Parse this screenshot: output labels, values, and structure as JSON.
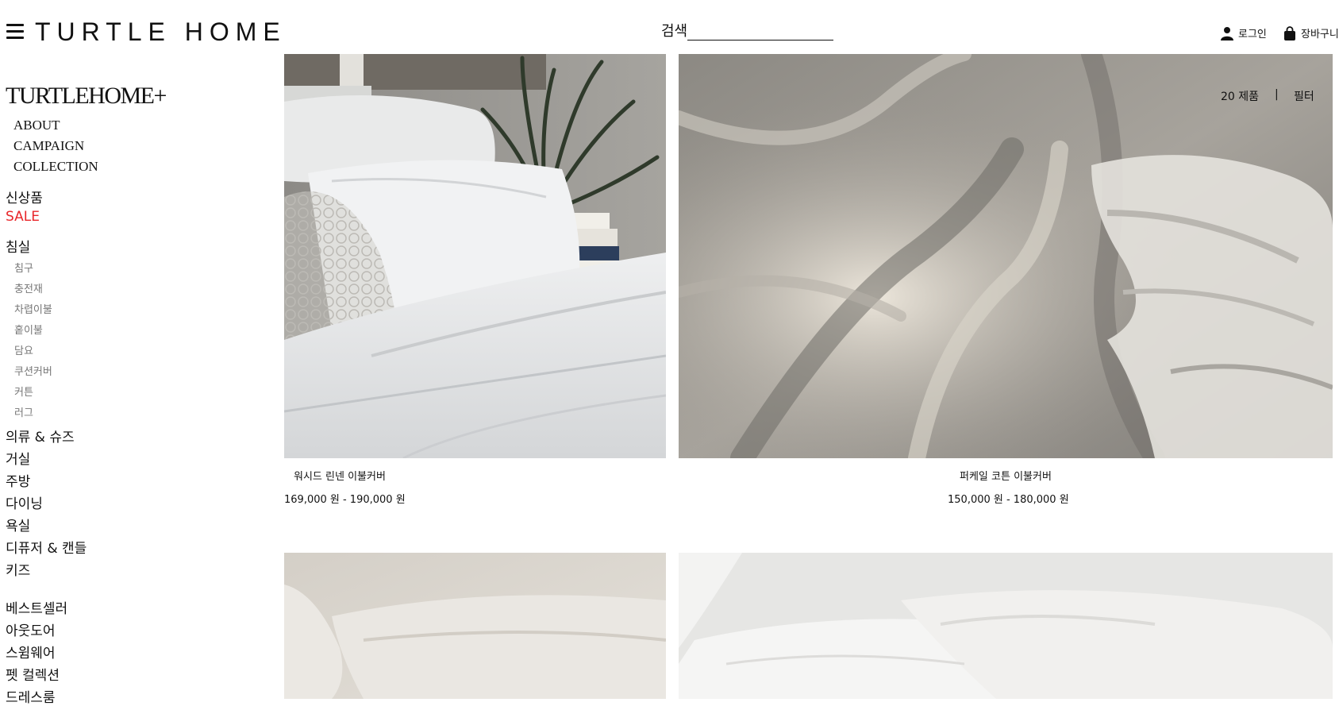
{
  "header": {
    "logo": "TURTLE HOME",
    "search_label": "검색",
    "login_label": "로그인",
    "cart_label": "장바구니"
  },
  "sidebar": {
    "brand": "TURTLEHOME+",
    "brand_links": [
      "ABOUT",
      "CAMPAIGN",
      "COLLECTION"
    ],
    "highlights": [
      "신상품",
      "SALE"
    ],
    "bedroom": {
      "label": "침실",
      "items": [
        "침구",
        "충전재",
        "차렵이불",
        "홑이불",
        "담요",
        "쿠션커버",
        "커튼",
        "러그"
      ]
    },
    "categories": [
      "의류 & 슈즈",
      "거실",
      "주방",
      "다이닝",
      "욕실",
      "디퓨저 & 캔들",
      "키즈"
    ],
    "extra": [
      "베스트셀러",
      "아웃도어",
      "스윔웨어",
      "펫 컬렉션",
      "드레스룸"
    ]
  },
  "toolbar": {
    "count": "20 제품",
    "separator": "|",
    "filter": "필터"
  },
  "products": [
    {
      "name": "워시드 린넨 이불커버",
      "price": "169,000 원 - 190,000 원"
    },
    {
      "name": "퍼케일 코튼 이불커버",
      "price": "150,000 원 - 180,000 원"
    }
  ],
  "colors": {
    "sale": "#e8262a",
    "sub_item": "#777777",
    "text": "#111111"
  }
}
